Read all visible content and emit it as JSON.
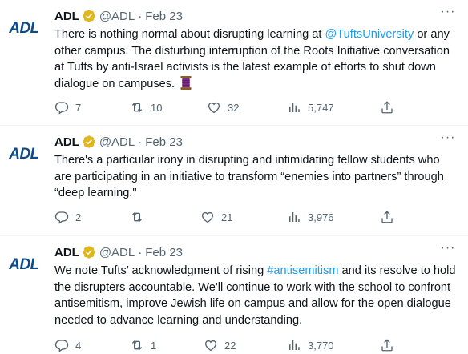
{
  "tweets": [
    {
      "avatar_text": "ADL",
      "name": "ADL",
      "handle": "@ADL",
      "separator": "·",
      "date": "Feb 23",
      "more": "···",
      "text_before": "There is nothing normal about disrupting learning at ",
      "mention": "@TuftsUniversity",
      "text_after": " or any other campus. The disturbing interruption of the Roots Initiative conversation at Tufts by anti-Israel activists is the latest example of efforts to shut down dialogue on campuses.",
      "emoji": "spool-of-thread",
      "replies": "7",
      "retweets": "10",
      "likes": "32",
      "views": "5,747"
    },
    {
      "avatar_text": "ADL",
      "name": "ADL",
      "handle": "@ADL",
      "separator": "·",
      "date": "Feb 23",
      "more": "···",
      "text": "There's a particular irony in disrupting and intimidating fellow students who are participating in an initiative to transform “enemies into partners” through “deep learning.\"",
      "replies": "2",
      "retweets": "",
      "likes": "21",
      "views": "3,976"
    },
    {
      "avatar_text": "ADL",
      "name": "ADL",
      "handle": "@ADL",
      "separator": "·",
      "date": "Feb 23",
      "more": "···",
      "text_before": "We note Tufts’ acknowledgment of rising ",
      "hashtag": "#antisemitism",
      "text_after": " and its resolve to hold the disrupters accountable. We'll continue to work with the school to confront antisemitism, improve Jewish life on campus and allow for the open dialogue needed to advance learning and understanding.",
      "replies": "4",
      "retweets": "1",
      "likes": "22",
      "views": "3,770"
    }
  ],
  "colors": {
    "text": "#0f1419",
    "muted": "#536471",
    "link": "#1d9bf0",
    "verified_gold": "#e2b719",
    "adl_blue": "#0c4a8a"
  }
}
